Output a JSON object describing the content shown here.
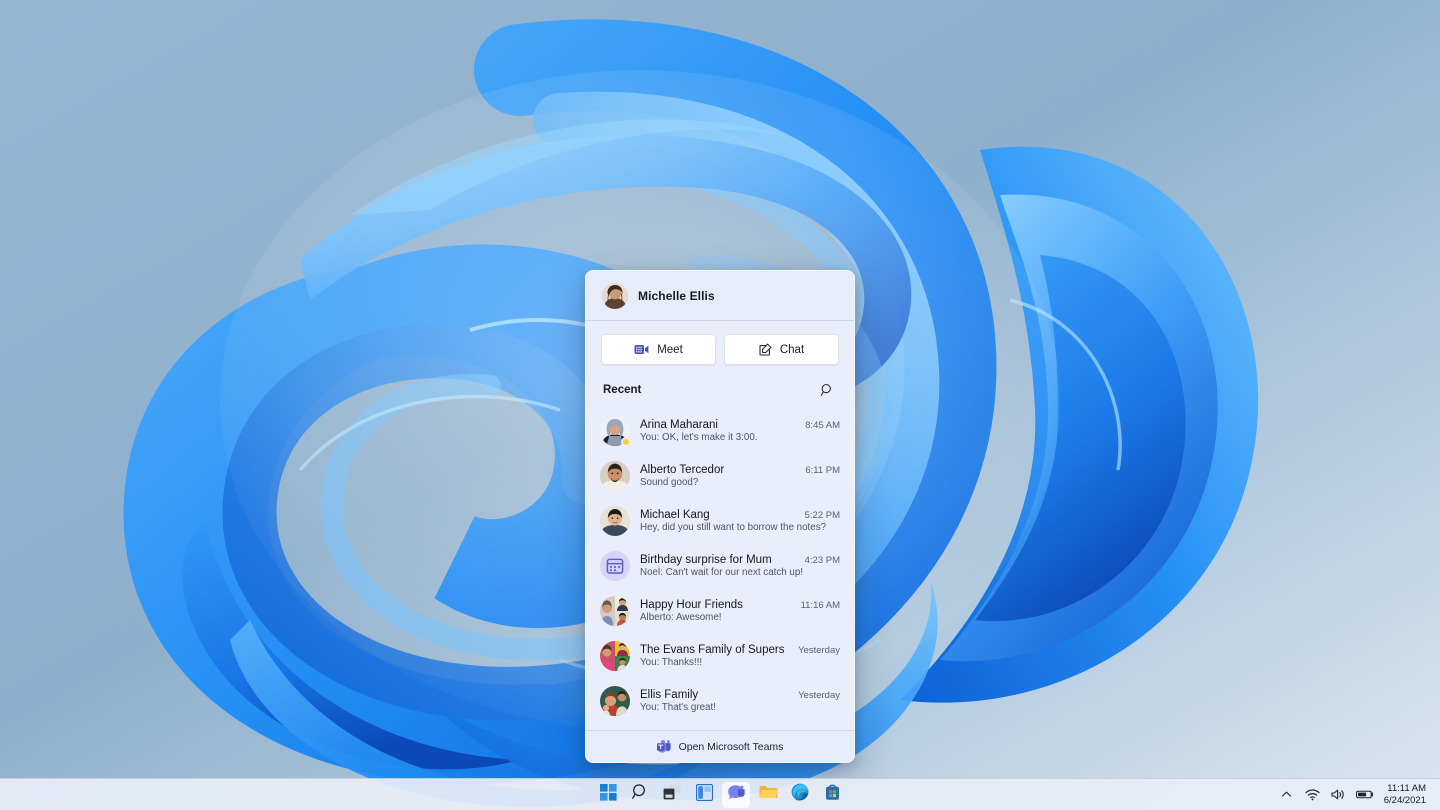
{
  "desktop": {
    "wallpaper_name": "windows-11-bloom-wallpaper",
    "background_color": "#8fb0cc"
  },
  "flyout": {
    "header": {
      "user_name": "Michelle Ellis",
      "avatar_name": "michelle-ellis-avatar"
    },
    "actions": [
      {
        "label": "Meet",
        "icon": "video-camera-icon",
        "name": "meet-button"
      },
      {
        "label": "Chat",
        "icon": "compose-chat-icon",
        "name": "chat-button"
      }
    ],
    "recent": {
      "label": "Recent",
      "search_icon": "search-icon"
    },
    "chats": [
      {
        "name": "Arina Maharani",
        "preview": "You: OK, let's make it 3:00.",
        "time": "8:45 AM",
        "avatar_type": "photo",
        "presence": "away"
      },
      {
        "name": "Alberto Tercedor",
        "preview": "Sound good?",
        "time": "6:11 PM",
        "avatar_type": "photo",
        "presence": "none"
      },
      {
        "name": "Michael Kang",
        "preview": "Hey, did you still want to borrow the notes?",
        "time": "5:22 PM",
        "avatar_type": "photo",
        "presence": "none"
      },
      {
        "name": "Birthday surprise for Mum",
        "preview": "Noel: Can't wait for our next catch up!",
        "time": "4:23 PM",
        "avatar_type": "group-icon",
        "presence": "none"
      },
      {
        "name": "Happy Hour Friends",
        "preview": "Alberto: Awesome!",
        "time": "11:16 AM",
        "avatar_type": "collage",
        "presence": "none"
      },
      {
        "name": "The Evans Family of Supers",
        "preview": "You: Thanks!!!",
        "time": "Yesterday",
        "avatar_type": "collage",
        "presence": "none"
      },
      {
        "name": "Ellis Family",
        "preview": "You: That's great!",
        "time": "Yesterday",
        "avatar_type": "photo",
        "presence": "none"
      }
    ],
    "footer": {
      "label": "Open Microsoft Teams",
      "icon": "microsoft-teams-icon"
    }
  },
  "taskbar": {
    "buttons": [
      {
        "name": "start-button",
        "icon": "windows-logo-icon",
        "active": false
      },
      {
        "name": "search-button",
        "icon": "search-icon",
        "active": false
      },
      {
        "name": "task-view-button",
        "icon": "task-view-icon",
        "active": false
      },
      {
        "name": "widgets-button",
        "icon": "widgets-icon",
        "active": false
      },
      {
        "name": "chat-teams-button",
        "icon": "teams-chat-icon",
        "active": true
      },
      {
        "name": "file-explorer-button",
        "icon": "file-explorer-icon",
        "active": false
      },
      {
        "name": "microsoft-edge-button",
        "icon": "edge-icon",
        "active": false
      },
      {
        "name": "microsoft-store-button",
        "icon": "store-icon",
        "active": false
      }
    ],
    "tray": {
      "chevron": "show-hidden-icons-chevron",
      "network": "wifi-icon",
      "volume": "speaker-icon",
      "battery": "battery-icon",
      "time": "11:11 AM",
      "date": "6/24/2021"
    }
  }
}
